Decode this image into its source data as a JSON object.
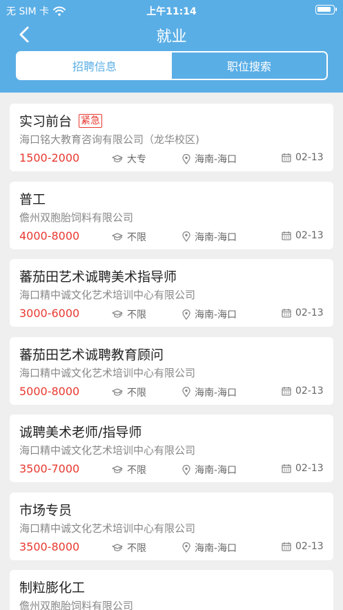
{
  "status": {
    "carrier": "无 SIM 卡",
    "time": "上午11:14"
  },
  "nav": {
    "title": "就业"
  },
  "tabs": [
    {
      "label": "招聘信息",
      "active": true
    },
    {
      "label": "职位搜索",
      "active": false
    }
  ],
  "colors": {
    "primary": "#5aaee6",
    "salary": "#e8382f",
    "background": "#efefef"
  },
  "jobs": [
    {
      "title": "实习前台",
      "badge": "紧急",
      "company": "海口铭大教育咨询有限公司（龙华校区)",
      "salary": "1500-2000",
      "education": "大专",
      "location": "海南-海口",
      "date": "02-13"
    },
    {
      "title": "普工",
      "company": "儋州双胞胎饲料有限公司",
      "salary": "4000-8000",
      "education": "不限",
      "location": "海南-海口",
      "date": "02-13"
    },
    {
      "title": "蕃茄田艺术诚聘美术指导师",
      "company": "海口精中诚文化艺术培训中心有限公司",
      "salary": "3000-6000",
      "education": "不限",
      "location": "海南-海口",
      "date": "02-13"
    },
    {
      "title": "蕃茄田艺术诚聘教育顾问",
      "company": "海口精中诚文化艺术培训中心有限公司",
      "salary": "5000-8000",
      "education": "不限",
      "location": "海南-海口",
      "date": "02-13"
    },
    {
      "title": "诚聘美术老师/指导师",
      "company": "海口精中诚文化艺术培训中心有限公司",
      "salary": "3500-7000",
      "education": "不限",
      "location": "海南-海口",
      "date": "02-13"
    },
    {
      "title": "市场专员",
      "company": "海口精中诚文化艺术培训中心有限公司",
      "salary": "3500-8000",
      "education": "不限",
      "location": "海南-海口",
      "date": "02-13"
    },
    {
      "title": "制粒膨化工",
      "company": "儋州双胞胎饲料有限公司"
    }
  ]
}
